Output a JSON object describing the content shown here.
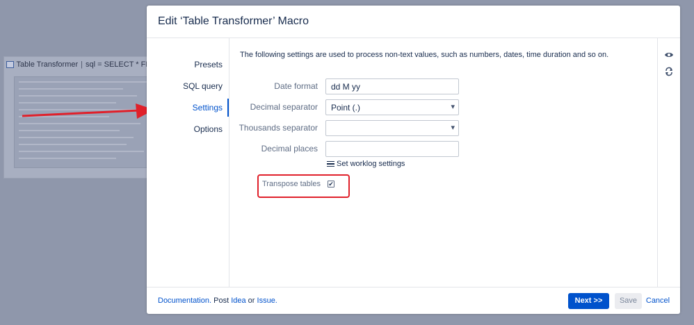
{
  "background": {
    "macro_title": "Table Transformer",
    "macro_params": "sql = SELECT * FROM",
    "separator": "|"
  },
  "dialog": {
    "title": "Edit ‘Table Transformer’ Macro",
    "nav": [
      {
        "label": "Presets",
        "active": false
      },
      {
        "label": "SQL query",
        "active": false
      },
      {
        "label": "Settings",
        "active": true
      },
      {
        "label": "Options",
        "active": false
      }
    ],
    "intro": "The following settings are used to process non-text values, such as numbers, dates, time duration and so on.",
    "fields": {
      "date_format": {
        "label": "Date format",
        "value": "dd M yy"
      },
      "decimal_separator": {
        "label": "Decimal separator",
        "value": "Point (.)"
      },
      "thousands_separator": {
        "label": "Thousands separator",
        "value": ""
      },
      "decimal_places": {
        "label": "Decimal places",
        "value": ""
      }
    },
    "worklog_label": "Set worklog settings",
    "transpose": {
      "label": "Transpose tables",
      "checked": true,
      "check_glyph": "✔"
    },
    "side_icons": [
      "eye-icon",
      "refresh-icon"
    ],
    "footer": {
      "documentation": "Documentation.",
      "post": "Post",
      "idea": "Idea",
      "or": "or",
      "issue": "Issue.",
      "next": "Next >>",
      "save": "Save",
      "cancel": "Cancel"
    }
  },
  "colors": {
    "accent": "#0052cc",
    "highlight": "#e0202a",
    "overlay": "#8f97ab"
  }
}
